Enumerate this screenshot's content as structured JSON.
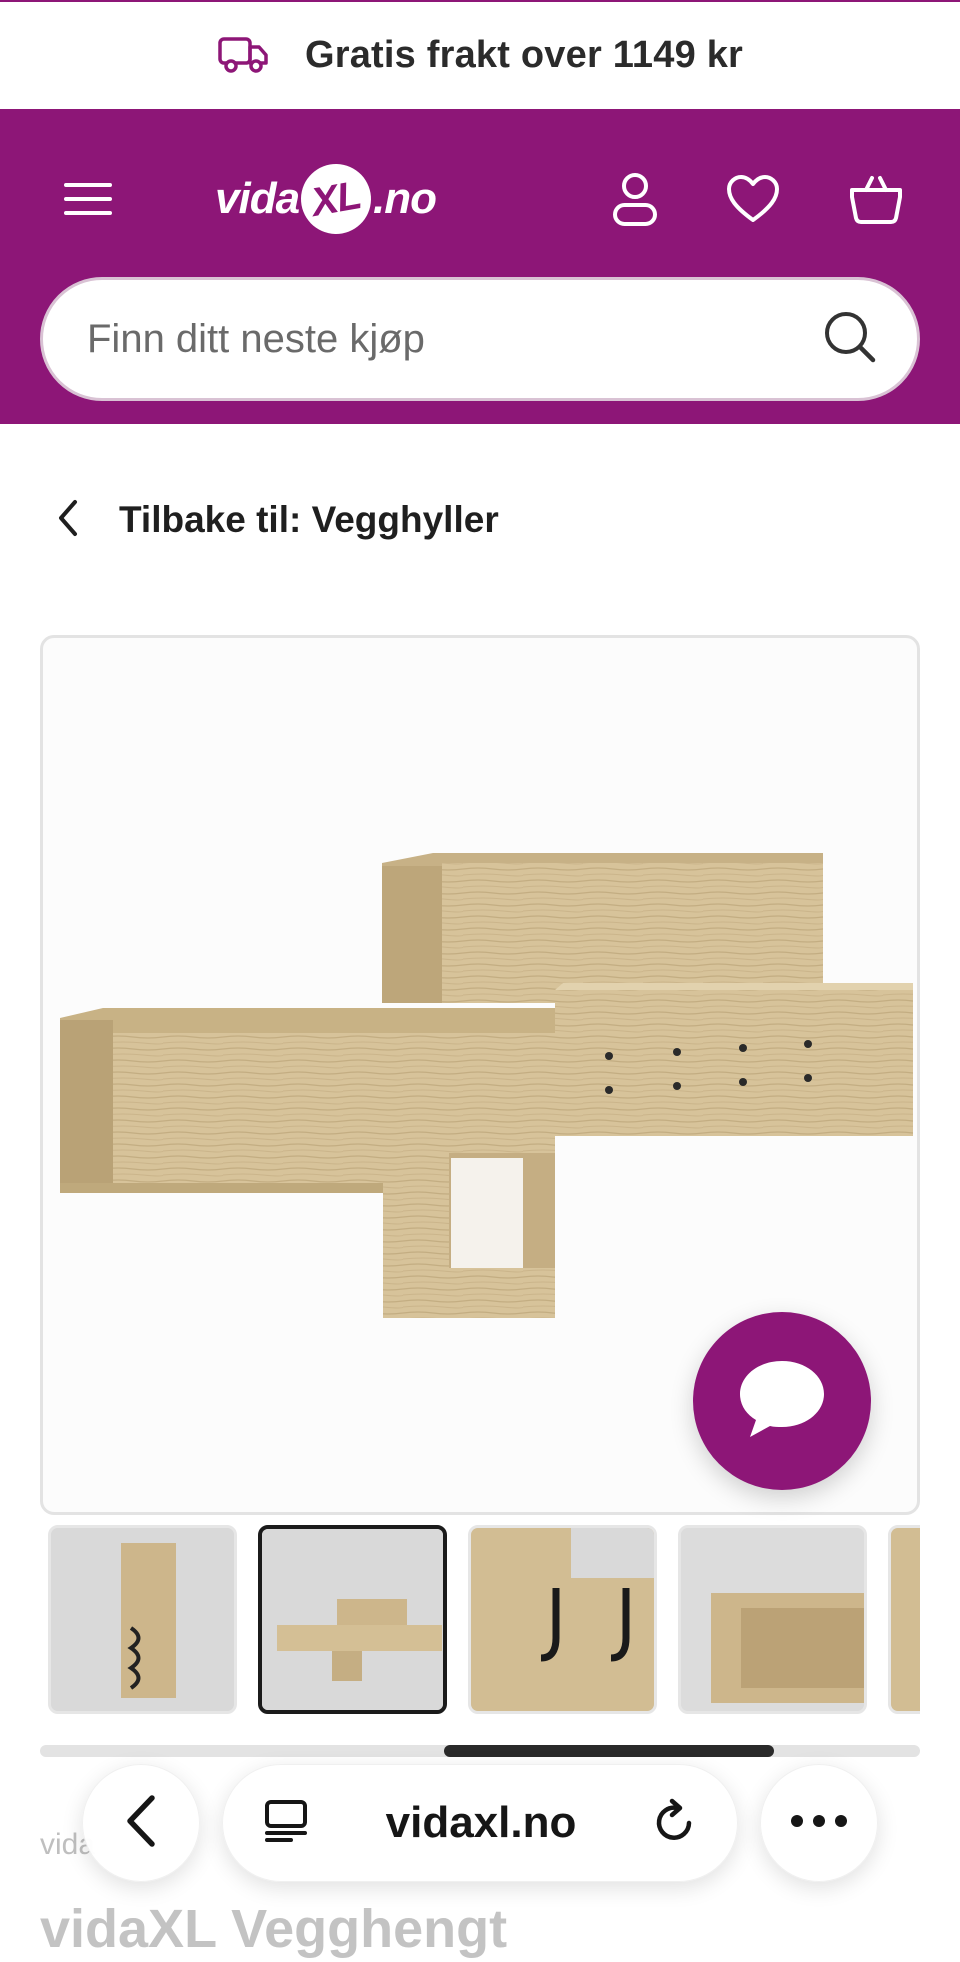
{
  "promo": {
    "text": "Gratis frakt over 1149 kr",
    "icon": "delivery-truck-icon"
  },
  "header": {
    "background_color": "#8d1677",
    "logo": {
      "prefix": "vida",
      "xl": "XL",
      "suffix": ".no"
    },
    "icons": [
      "menu-icon",
      "account-icon",
      "wishlist-heart-icon",
      "basket-icon"
    ],
    "search": {
      "placeholder": "Finn ditt neste kjøp",
      "icon": "search-icon"
    }
  },
  "breadcrumb": {
    "label": "Tilbake til: Vegghyller",
    "icon": "chevron-left-icon"
  },
  "product": {
    "main_image": "wall-shelf-oak-image",
    "thumbnails": [
      "thumb-side-hooks",
      "thumb-full-shelf",
      "thumb-black-hooks",
      "thumb-shelf-detail",
      "thumb-partial"
    ],
    "selected_thumbnail": 1,
    "brand": "vida",
    "title": "vidaXL Vegghengt"
  },
  "chat": {
    "icon": "chat-bubble-icon",
    "color": "#8d1677"
  },
  "browser": {
    "back_icon": "back-arrow-icon",
    "reader_icon": "reader-mode-icon",
    "address": "vidaxl.no",
    "reload_icon": "reload-icon",
    "more_icon": "more-dots-icon"
  }
}
